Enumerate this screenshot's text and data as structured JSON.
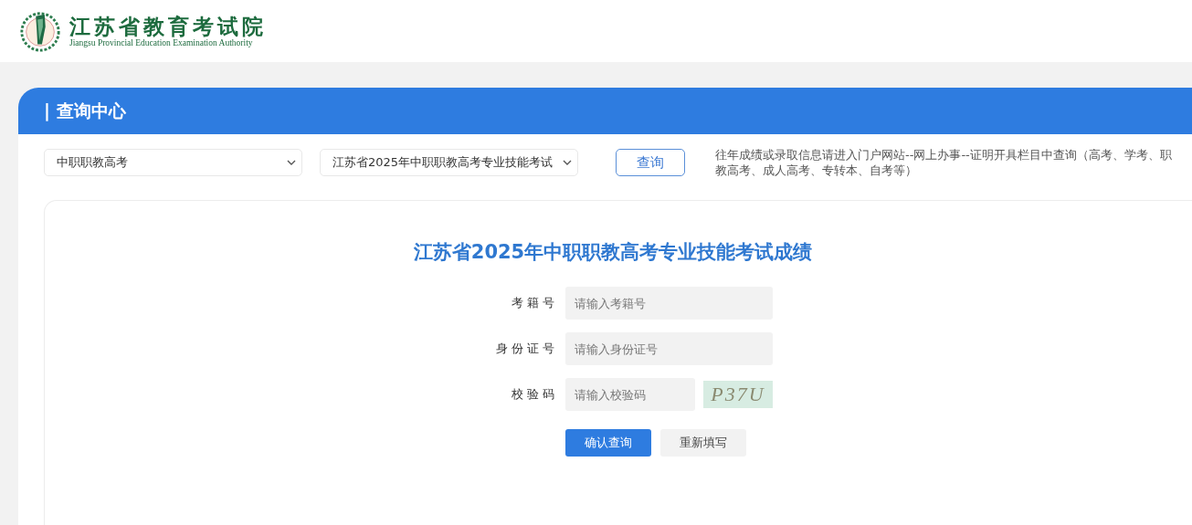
{
  "header": {
    "logo_title": "江苏省教育考试院",
    "logo_subtitle": "Jiangsu Provincial Education Examination Authority"
  },
  "section_title": "| 查询中心",
  "filters": [
    {
      "value": "中职职教高考"
    },
    {
      "value": "江苏省2025年中职职教高考专业技能考试"
    }
  ],
  "query_button": "查询",
  "notice": "往年成绩或录取信息请进入门户网站--网上办事--证明开具栏目中查询（高考、学考、职教高考、成人高考、专转本、自考等）",
  "form": {
    "title": "江苏省2025年中职职教高考专业技能考试成绩",
    "fields": [
      {
        "label": "考 籍 号",
        "placeholder": "请输入考籍号",
        "kind": "text"
      },
      {
        "label": "身 份 证 号",
        "placeholder": "请输入身份证号",
        "kind": "text"
      },
      {
        "label": "校 验 码",
        "placeholder": "请输入校验码",
        "kind": "captcha",
        "captcha": "P37U"
      }
    ],
    "buttons": [
      {
        "label": "确认查询",
        "kind": "primary"
      },
      {
        "label": "重新填写",
        "kind": "secondary"
      }
    ]
  }
}
